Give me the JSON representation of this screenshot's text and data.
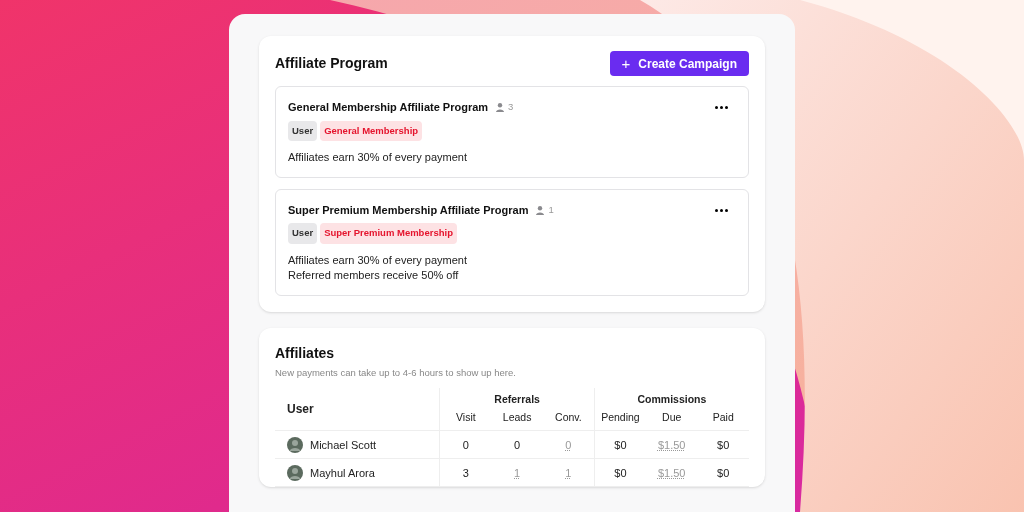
{
  "program": {
    "title": "Affiliate Program",
    "create_button": {
      "icon": "+",
      "label": "Create Campaign"
    },
    "campaigns": [
      {
        "name": "General Membership Affiliate Program",
        "member_count": "3",
        "tags": [
          {
            "label": "User",
            "kind": "neutral"
          },
          {
            "label": "General Membership",
            "kind": "plan"
          }
        ],
        "lines": [
          "Affiliates earn 30% of every payment"
        ]
      },
      {
        "name": "Super Premium Membership Affiliate Program",
        "member_count": "1",
        "tags": [
          {
            "label": "User",
            "kind": "neutral"
          },
          {
            "label": "Super Premium Membership",
            "kind": "plan"
          }
        ],
        "lines": [
          "Affiliates earn 30% of every payment",
          "Referred members receive 50% off"
        ]
      }
    ]
  },
  "affiliates": {
    "title": "Affiliates",
    "subtitle": "New payments can take up to 4-6 hours to show up here.",
    "table": {
      "user_header": "User",
      "groups": [
        {
          "label": "Referrals",
          "columns": [
            "Visit",
            "Leads",
            "Conv."
          ]
        },
        {
          "label": "Commissions",
          "columns": [
            "Pending",
            "Due",
            "Paid"
          ]
        }
      ],
      "rows": [
        {
          "user": "Michael Scott",
          "cells": [
            {
              "text": "0",
              "linked": false
            },
            {
              "text": "0",
              "linked": false
            },
            {
              "text": "0",
              "linked": true
            },
            {
              "text": "$0",
              "linked": false
            },
            {
              "text": "$1.50",
              "linked": true
            },
            {
              "text": "$0",
              "linked": false
            }
          ]
        },
        {
          "user": "Mayhul Arora",
          "cells": [
            {
              "text": "3",
              "linked": false
            },
            {
              "text": "1",
              "linked": true
            },
            {
              "text": "1",
              "linked": true
            },
            {
              "text": "$0",
              "linked": false
            },
            {
              "text": "$1.50",
              "linked": true
            },
            {
              "text": "$0",
              "linked": false
            }
          ]
        }
      ]
    }
  }
}
